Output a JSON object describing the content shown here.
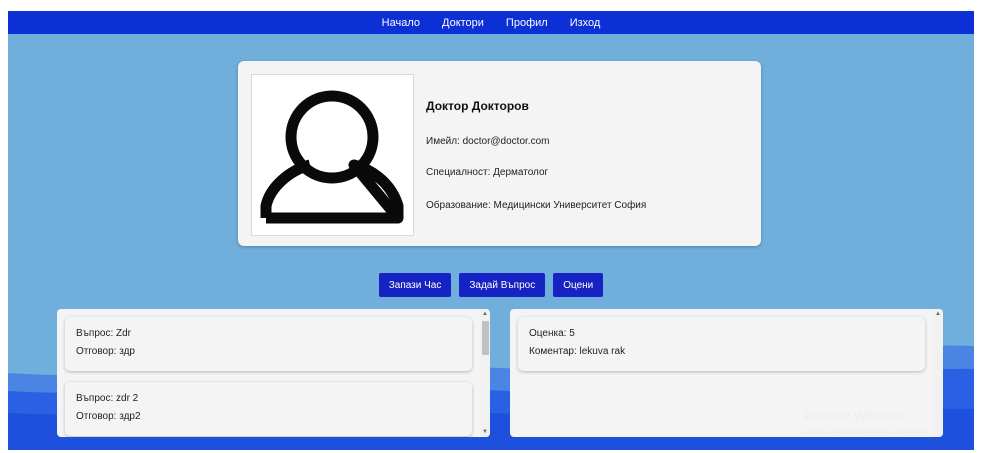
{
  "nav": {
    "items": [
      "Начало",
      "Доктори",
      "Профил",
      "Изход"
    ]
  },
  "profile": {
    "name": "Доктор Докторов",
    "email_line": "Имейл: doctor@doctor.com",
    "specialty_line": "Специалност: Дерматолог",
    "education_line": "Образование: Медицински Университет София",
    "avatar_icon": "user-icon"
  },
  "actions": {
    "book": "Запази Час",
    "ask": "Задай Въпрос",
    "rate": "Оцени"
  },
  "questions": [
    {
      "question": "Въпрос: Zdr",
      "answer": "Отговор: здр"
    },
    {
      "question": "Въпрос: zdr 2",
      "answer": "Отговор: здр2"
    }
  ],
  "reviews": [
    {
      "rating": "Оценка: 5",
      "comment": "Коментар: lekuva rak"
    }
  ],
  "watermark": {
    "title": "Activate Windows",
    "subtitle": "Go to Settings to activate Windows."
  },
  "colors": {
    "navbar": "#0d2fd6",
    "background": "#70aedc",
    "button": "#1623c2",
    "wave": "#2a60e4"
  }
}
